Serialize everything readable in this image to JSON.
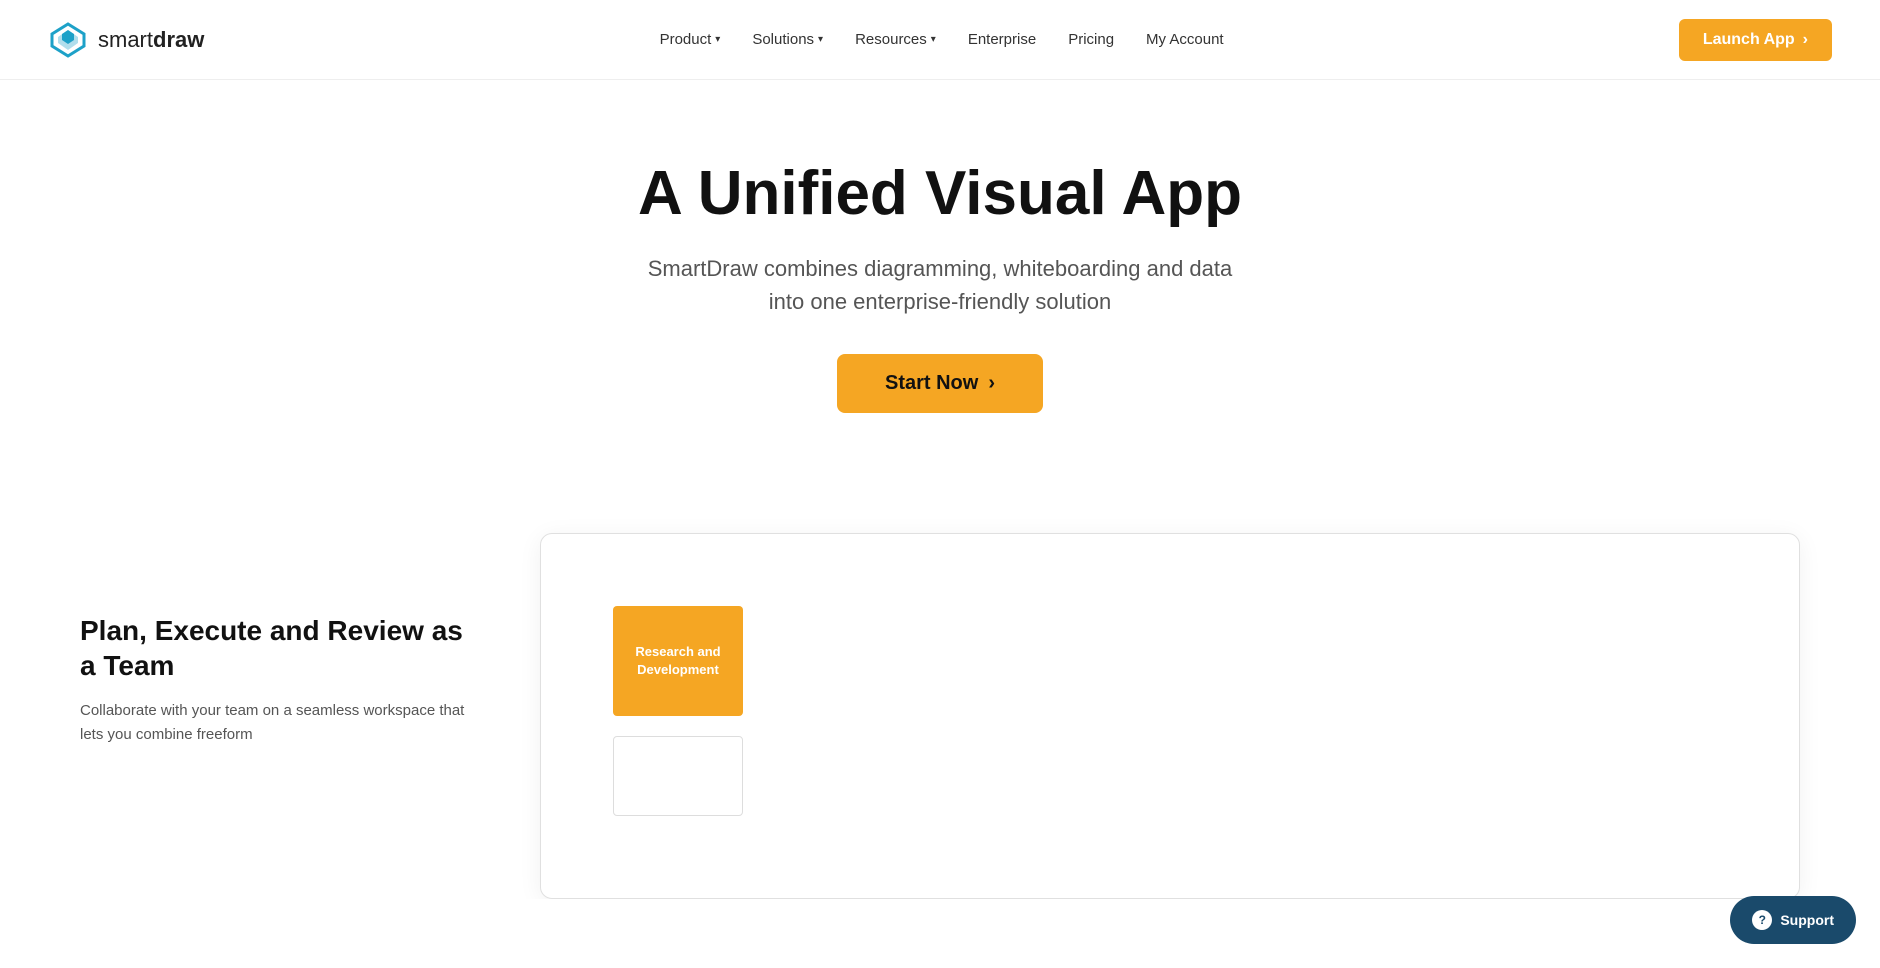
{
  "brand": {
    "name_part1": "smart",
    "name_part2": "draw"
  },
  "nav": {
    "links": [
      {
        "id": "product",
        "label": "Product",
        "has_dropdown": true
      },
      {
        "id": "solutions",
        "label": "Solutions",
        "has_dropdown": true
      },
      {
        "id": "resources",
        "label": "Resources",
        "has_dropdown": true
      },
      {
        "id": "enterprise",
        "label": "Enterprise",
        "has_dropdown": false
      },
      {
        "id": "pricing",
        "label": "Pricing",
        "has_dropdown": false
      },
      {
        "id": "my-account",
        "label": "My Account",
        "has_dropdown": false
      }
    ],
    "launch_button": "Launch App",
    "launch_button_arrow": "›"
  },
  "hero": {
    "title": "A Unified Visual App",
    "subtitle": "SmartDraw combines diagramming, whiteboarding and data into one enterprise-friendly solution",
    "cta_label": "Start Now",
    "cta_arrow": "›"
  },
  "lower": {
    "heading": "Plan, Execute and Review as a Team",
    "body": "Collaborate with your team on a seamless workspace that lets you combine freeform"
  },
  "diagram": {
    "card_label": "Research and Development"
  },
  "support": {
    "label": "Support",
    "icon": "?"
  }
}
